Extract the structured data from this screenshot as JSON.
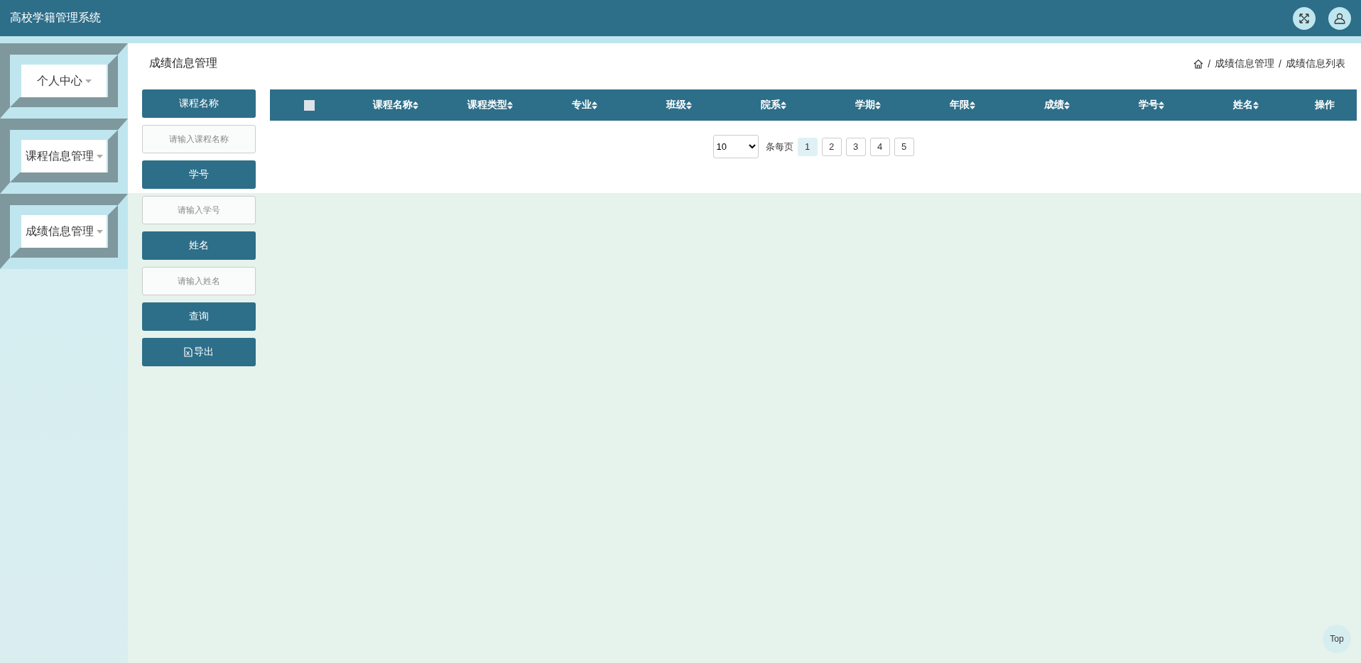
{
  "header": {
    "title": "高校学籍管理系统"
  },
  "sidebar": {
    "items": [
      {
        "label": "个人中心",
        "expanded": false
      },
      {
        "label": "课程信息管理",
        "expanded": false
      },
      {
        "label": "成绩信息管理",
        "expanded": false
      }
    ]
  },
  "page": {
    "title": "成绩信息管理",
    "breadcrumb": [
      "成绩信息管理",
      "成绩信息列表"
    ],
    "breadcrumb_separator": "/"
  },
  "filters": [
    {
      "label": "课程名称",
      "placeholder": "请输入课程名称"
    },
    {
      "label": "学号",
      "placeholder": "请输入学号"
    },
    {
      "label": "姓名",
      "placeholder": "请输入姓名"
    }
  ],
  "actions": [
    {
      "label": "查询",
      "kind": "search"
    },
    {
      "label": "导出",
      "kind": "export"
    }
  ],
  "table": {
    "select_all": {
      "checked": false
    },
    "columns": [
      {
        "label": "课程名称",
        "sortable": true
      },
      {
        "label": "课程类型",
        "sortable": true
      },
      {
        "label": "专业",
        "sortable": true
      },
      {
        "label": "班级",
        "sortable": true
      },
      {
        "label": "院系",
        "sortable": true
      },
      {
        "label": "学期",
        "sortable": true
      },
      {
        "label": "年限",
        "sortable": true
      },
      {
        "label": "成绩",
        "sortable": true
      },
      {
        "label": "学号",
        "sortable": true
      },
      {
        "label": "姓名",
        "sortable": true
      },
      {
        "label": "操作",
        "sortable": false
      }
    ]
  },
  "pagination": {
    "page_size": "10",
    "page_size_label": "条每页",
    "pages": [
      {
        "label": "1",
        "selected": true
      },
      {
        "label": "2",
        "selected": false
      },
      {
        "label": "3",
        "selected": false
      },
      {
        "label": "4",
        "selected": false
      },
      {
        "label": "5",
        "selected": false
      }
    ]
  },
  "back_to_top": "Top"
}
